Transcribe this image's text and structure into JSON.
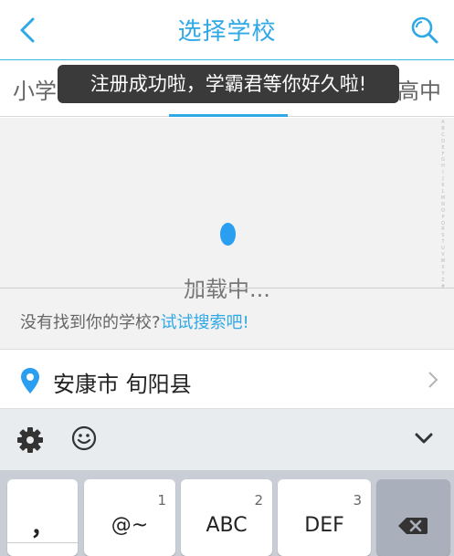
{
  "header": {
    "title": "选择学校",
    "back_icon": "chevron-left-icon",
    "search_icon": "search-icon",
    "accent_color": "#2fa8e6"
  },
  "tabs": {
    "left_label": "小学",
    "right_label": "高中",
    "active_index": 1
  },
  "toast": {
    "message": "注册成功啦，学霸君等你好久啦!"
  },
  "content": {
    "alphabet_index": "ABCDEFGHIJKLMNOPQRSTUVWXYZ#",
    "loading_text": "加载中...",
    "not_found_text": "没有找到你的学校?",
    "search_link": "试试搜索吧!"
  },
  "location": {
    "icon": "location-pin-icon",
    "text": "安康市 旬阳县",
    "chevron_icon": "chevron-right-icon"
  },
  "keyboard": {
    "toolbar": {
      "settings_icon": "gear-icon",
      "emoji_icon": "smiley-icon",
      "collapse_icon": "chevron-down-icon"
    },
    "keys": [
      {
        "label": "，",
        "number": ""
      },
      {
        "label": "@~",
        "number": "1"
      },
      {
        "label": "ABC",
        "number": "2"
      },
      {
        "label": "DEF",
        "number": "3"
      }
    ],
    "delete_icon": "backspace-icon"
  }
}
